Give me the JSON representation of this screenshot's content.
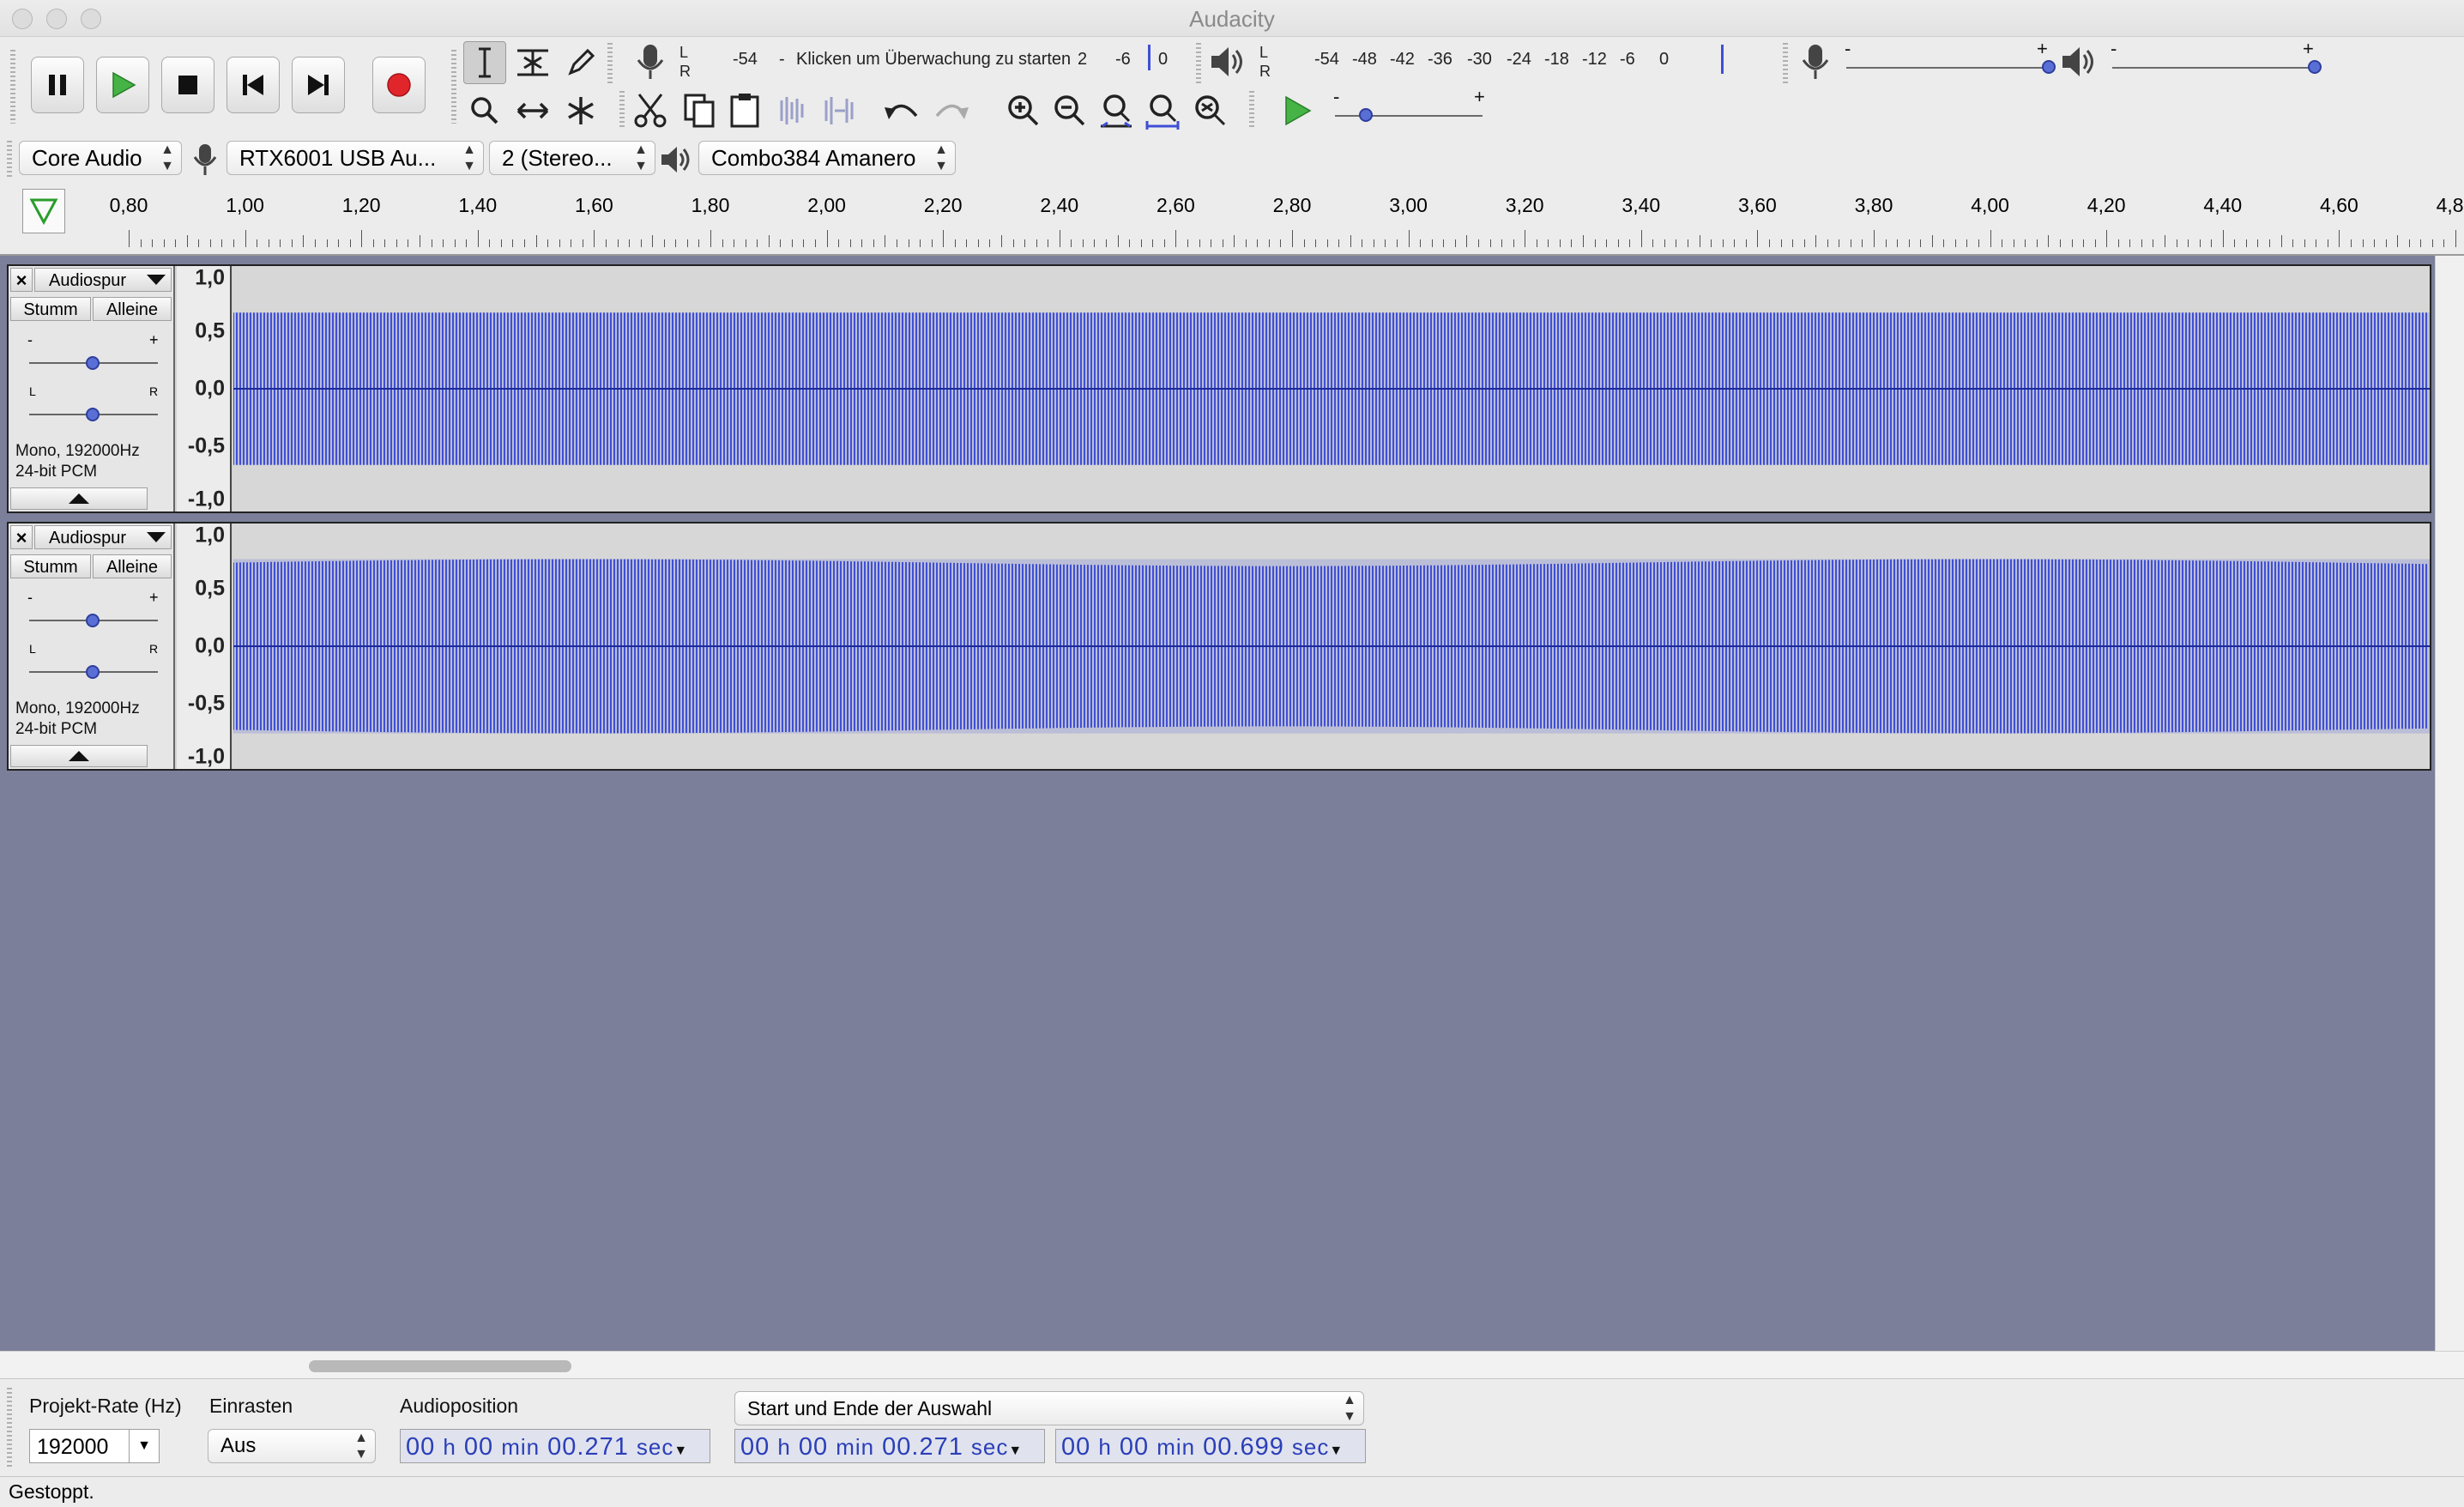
{
  "window": {
    "title": "Audacity"
  },
  "meters": {
    "record_scale": [
      "-54",
      "-",
      "Klicken um Überwachung zu starten",
      "2",
      "-6",
      "0"
    ],
    "play_scale": [
      "-54",
      "-48",
      "-42",
      "-36",
      "-30",
      "-24",
      "-18",
      "-12",
      "-6",
      "0"
    ],
    "channel_l": "L",
    "channel_r": "R"
  },
  "mixer": {
    "minus": "-",
    "plus": "+",
    "record_volume": 1.0,
    "playback_volume": 1.0
  },
  "play_at_speed": {
    "minus": "-",
    "plus": "+",
    "speed": 0.22
  },
  "device": {
    "host": "Core Audio",
    "record_device": "RTX6001 USB Au...",
    "channels": "2 (Stereo...",
    "playback_device": "Combo384 Amanero"
  },
  "ruler": {
    "labels": [
      "0,80",
      "1,00",
      "1,20",
      "1,40",
      "1,60",
      "1,80",
      "2,00",
      "2,20",
      "2,40",
      "2,60",
      "2,80",
      "3,00",
      "3,20",
      "3,40",
      "3,60",
      "3,80",
      "4,00",
      "4,20",
      "4,40",
      "4,60",
      "4,80"
    ]
  },
  "tracks": [
    {
      "name": "Audiospur",
      "close": "×",
      "mute": "Stumm",
      "solo": "Alleine",
      "gain_minus": "-",
      "gain_plus": "+",
      "pan_l": "L",
      "pan_r": "R",
      "info1": "Mono, 192000Hz",
      "info2": "24-bit PCM",
      "scale": [
        "1,0",
        "0,5",
        "0,0",
        "-0,5",
        "-1,0"
      ],
      "amplitude": 0.62,
      "color": "#3f4fd6"
    },
    {
      "name": "Audiospur",
      "close": "×",
      "mute": "Stumm",
      "solo": "Alleine",
      "gain_minus": "-",
      "gain_plus": "+",
      "pan_l": "L",
      "pan_r": "R",
      "info1": "Mono, 192000Hz",
      "info2": "24-bit PCM",
      "scale": [
        "1,0",
        "0,5",
        "0,0",
        "-0,5",
        "-1,0"
      ],
      "amplitude": 0.71,
      "color": "#3f4fd6"
    }
  ],
  "selection": {
    "rate_label": "Projekt-Rate (Hz)",
    "rate_value": "192000",
    "snap_label": "Einrasten",
    "snap_value": "Aus",
    "position_label": "Audioposition",
    "selection_mode": "Start und Ende der Auswahl",
    "position": {
      "h": "00",
      "m": "00",
      "s": "00.271"
    },
    "start": {
      "h": "00",
      "m": "00",
      "s": "00.271"
    },
    "end": {
      "h": "00",
      "m": "00",
      "s": "00.699"
    },
    "unit_h": "h",
    "unit_m": "min",
    "unit_s": "sec"
  },
  "status": {
    "text": "Gestoppt."
  },
  "colors": {
    "waveform": "#3f4fd6",
    "workspace": "#7b7f99",
    "record": "#e0262b",
    "play": "#3fb13f"
  }
}
